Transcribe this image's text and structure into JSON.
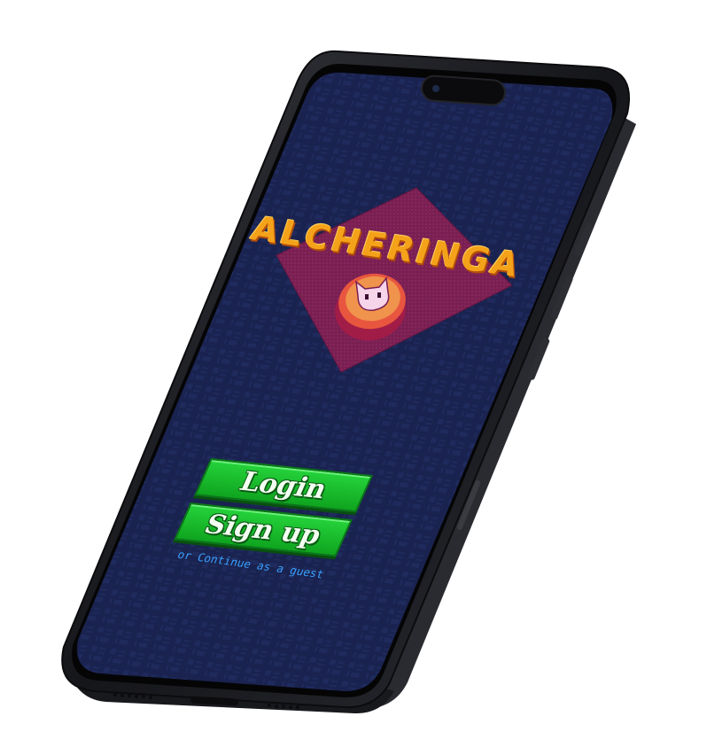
{
  "app": {
    "logo_text": "ALCHERINGA",
    "mascot": "cat-face-coin-icon"
  },
  "actions": {
    "login_label": "Login",
    "signup_label": "Sign up",
    "guest_label": "or Continue as a guest"
  },
  "colors": {
    "screen_bg": "#1a2350",
    "diamond": "#7a1f52",
    "button_green": "#1bbd2e",
    "logo_orange": "#f4a21a",
    "guest_link": "#3aa0ff",
    "phone_frame": "#1c1d21"
  }
}
